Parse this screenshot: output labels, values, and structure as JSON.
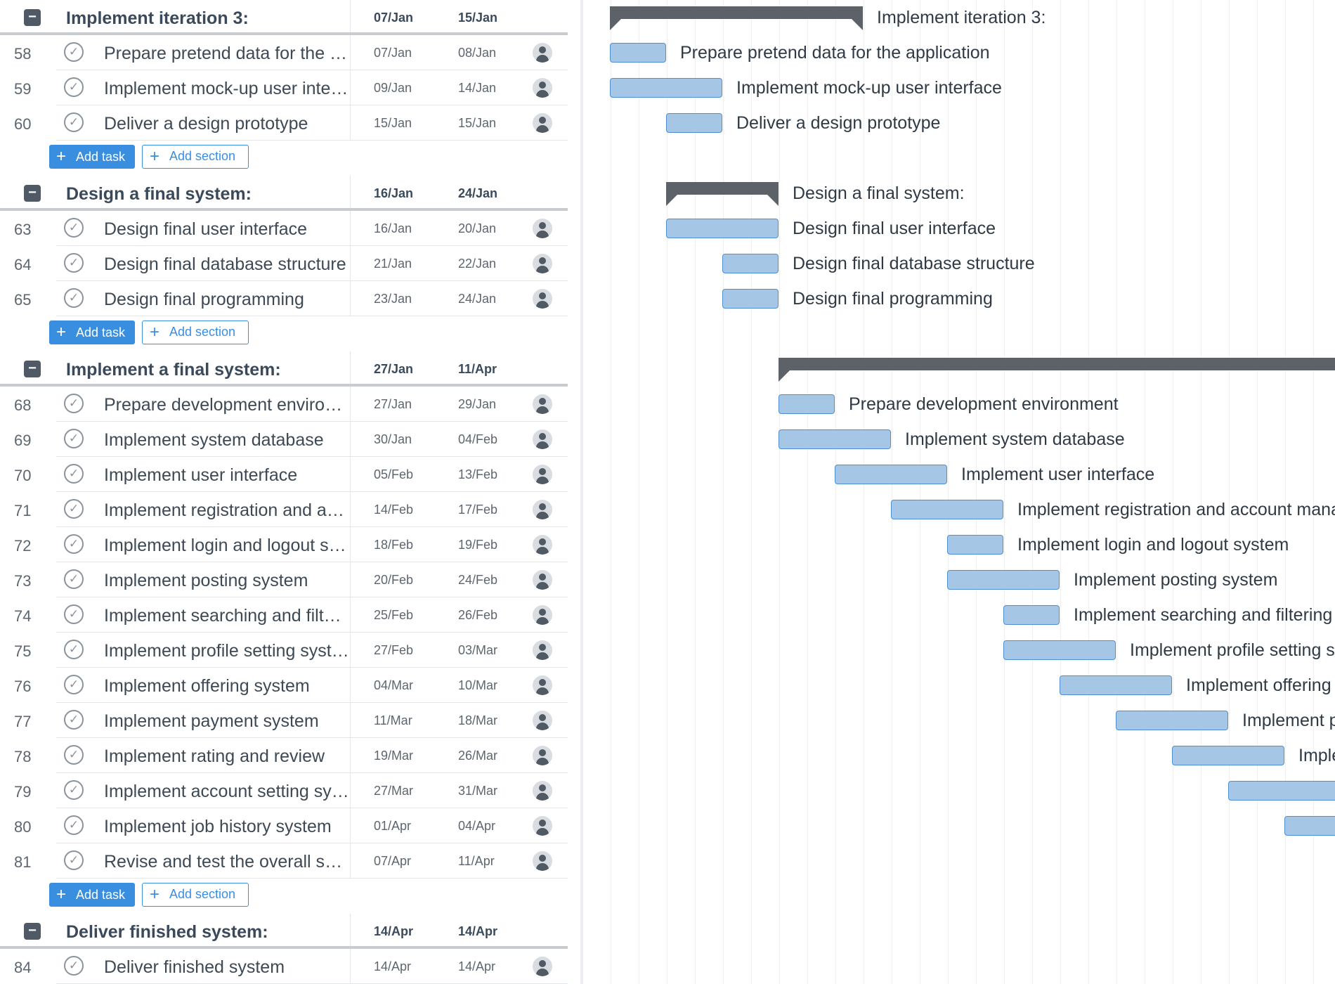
{
  "sections": [
    {
      "title": "Implement iteration 3:",
      "start": "07/Jan",
      "end": "15/Jan",
      "collapse_icon": "minus",
      "gantt_start_day": 0,
      "gantt_end_day": 9,
      "tasks": [
        {
          "num": "58",
          "name": "Prepare pretend data for the application",
          "start": "07/Jan",
          "end": "08/Jan",
          "day_start": 0,
          "day_end": 2
        },
        {
          "num": "59",
          "name": "Implement mock-up user interface",
          "start": "09/Jan",
          "end": "14/Jan",
          "day_start": 0,
          "day_end": 4
        },
        {
          "num": "60",
          "name": "Deliver a design prototype",
          "start": "15/Jan",
          "end": "15/Jan",
          "day_start": 2,
          "day_end": 4
        }
      ],
      "add_task_label": "Add task",
      "add_section_label": "Add section"
    },
    {
      "title": "Design a final system:",
      "start": "16/Jan",
      "end": "24/Jan",
      "collapse_icon": "minus",
      "gantt_start_day": 2,
      "gantt_end_day": 6,
      "tasks": [
        {
          "num": "63",
          "name": "Design final user interface",
          "start": "16/Jan",
          "end": "20/Jan",
          "day_start": 2,
          "day_end": 6
        },
        {
          "num": "64",
          "name": "Design final database structure",
          "start": "21/Jan",
          "end": "22/Jan",
          "day_start": 4,
          "day_end": 6
        },
        {
          "num": "65",
          "name": "Design final programming",
          "start": "23/Jan",
          "end": "24/Jan",
          "day_start": 4,
          "day_end": 6
        }
      ],
      "add_task_label": "Add task",
      "add_section_label": "Add section"
    },
    {
      "title": "Implement a final system:",
      "start": "27/Jan",
      "end": "11/Apr",
      "collapse_icon": "minus",
      "gantt_start_day": 6,
      "gantt_end_day": 28,
      "tasks": [
        {
          "num": "68",
          "name": "Prepare development environment",
          "start": "27/Jan",
          "end": "29/Jan",
          "day_start": 6,
          "day_end": 8
        },
        {
          "num": "69",
          "name": "Implement system database",
          "start": "30/Jan",
          "end": "04/Feb",
          "day_start": 6,
          "day_end": 10
        },
        {
          "num": "70",
          "name": "Implement user interface",
          "start": "05/Feb",
          "end": "13/Feb",
          "day_start": 8,
          "day_end": 12
        },
        {
          "num": "71",
          "name": "Implement registration and account management system",
          "start": "14/Feb",
          "end": "17/Feb",
          "day_start": 10,
          "day_end": 14
        },
        {
          "num": "72",
          "name": "Implement login and logout system",
          "start": "18/Feb",
          "end": "19/Feb",
          "day_start": 12,
          "day_end": 14
        },
        {
          "num": "73",
          "name": "Implement posting system",
          "start": "20/Feb",
          "end": "24/Feb",
          "day_start": 12,
          "day_end": 16
        },
        {
          "num": "74",
          "name": "Implement searching and filtering system",
          "start": "25/Feb",
          "end": "26/Feb",
          "day_start": 14,
          "day_end": 16
        },
        {
          "num": "75",
          "name": "Implement profile setting system",
          "start": "27/Feb",
          "end": "03/Mar",
          "day_start": 14,
          "day_end": 18
        },
        {
          "num": "76",
          "name": "Implement offering system",
          "start": "04/Mar",
          "end": "10/Mar",
          "day_start": 16,
          "day_end": 20
        },
        {
          "num": "77",
          "name": "Implement payment system",
          "start": "11/Mar",
          "end": "18/Mar",
          "day_start": 18,
          "day_end": 22
        },
        {
          "num": "78",
          "name": "Implement rating and review",
          "start": "19/Mar",
          "end": "26/Mar",
          "day_start": 20,
          "day_end": 24
        },
        {
          "num": "79",
          "name": "Implement account setting system",
          "start": "27/Mar",
          "end": "31/Mar",
          "day_start": 22,
          "day_end": 26
        },
        {
          "num": "80",
          "name": "Implement job history system",
          "start": "01/Apr",
          "end": "04/Apr",
          "day_start": 24,
          "day_end": 26
        },
        {
          "num": "81",
          "name": "Revise and test the overall system",
          "start": "07/Apr",
          "end": "11/Apr",
          "day_start": 26,
          "day_end": 28
        }
      ],
      "add_task_label": "Add task",
      "add_section_label": "Add section"
    },
    {
      "title": "Deliver finished system:",
      "start": "14/Apr",
      "end": "14/Apr",
      "collapse_icon": "minus",
      "gantt_start_day": 28,
      "gantt_end_day": 30,
      "tasks": [
        {
          "num": "84",
          "name": "Deliver finished system",
          "start": "14/Apr",
          "end": "14/Apr",
          "day_start": 28,
          "day_end": 30
        }
      ]
    }
  ],
  "icons": {
    "check": "check-circle-icon",
    "assignee": "user-avatar-icon",
    "plus": "plus-icon"
  },
  "colors": {
    "accent": "#3a8ee0",
    "task_bar": "#a6c6e6",
    "task_bar_border": "#4e8fd0",
    "summary_bar": "#5d6168"
  }
}
